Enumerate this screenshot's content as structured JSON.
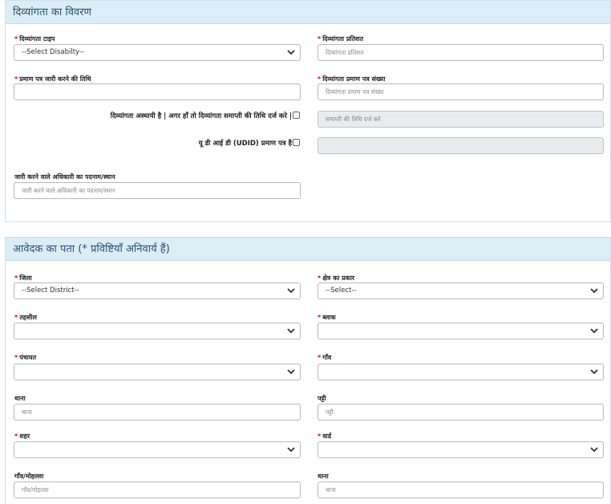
{
  "section1": {
    "title": "दिव्यांगता का विवरण",
    "disability_type": {
      "label": "दिव्यांगता टाइप",
      "value": "--Select Disabilty--"
    },
    "disability_percent": {
      "label": "दिव्यांगता प्रतिशत",
      "placeholder": "दिव्यांगता प्रतिशत"
    },
    "certificate_date": {
      "label": "प्रमाण पत्र जारी करने की तिथि",
      "value": ""
    },
    "certificate_number": {
      "label": "दिव्यांगता प्रमाण  पत्र संख्या",
      "placeholder": "दिव्यांगता प्रमाण  पत्र संख्या"
    },
    "temporary": {
      "label": "दिव्यांगता अस्थायी है | अगर हाँ तो दिव्यांगता समाप्ती की तिथि दर्ज करे |",
      "end_date_placeholder": "समाप्ती की तिथि दर्ज करे"
    },
    "udid": {
      "label": "यू डी आई डी (UDID) प्रमाण पत्र है",
      "value": ""
    },
    "issuing_officer": {
      "label": "जारी करने वाले अधिकारी का पदनाम/स्थान",
      "placeholder": "जारी करने वाले अधिकारी का पदनाम/स्थान"
    }
  },
  "section2": {
    "title": "आवेदक का पता (* प्रविष्टियाँ अनिवार्य हैं)",
    "district": {
      "label": "जिला",
      "value": "--Select District--"
    },
    "area_type": {
      "label": "क्षेत्र का प्रकार",
      "value": "--Select--"
    },
    "tehsil": {
      "label": "तहसील",
      "value": ""
    },
    "block": {
      "label": "ब्लाक",
      "value": ""
    },
    "panchayat": {
      "label": "पंचायत",
      "value": ""
    },
    "village": {
      "label": "गाँव",
      "value": ""
    },
    "thana": {
      "label": "थाना",
      "placeholder": "थाना"
    },
    "patti": {
      "label": "पट्टी",
      "placeholder": "पट्टी"
    },
    "city": {
      "label": "शहर",
      "value": ""
    },
    "ward": {
      "label": "वार्ड",
      "value": ""
    },
    "mohalla": {
      "label": "गाँव/मोहल्ला",
      "placeholder": "गाँव/मोहल्ला"
    },
    "thana2": {
      "label": "थाना",
      "placeholder": "थाना"
    }
  },
  "required_mark": "*",
  "icons": {
    "dropdown": "chevron-down-icon",
    "checkbox": "checkbox"
  }
}
